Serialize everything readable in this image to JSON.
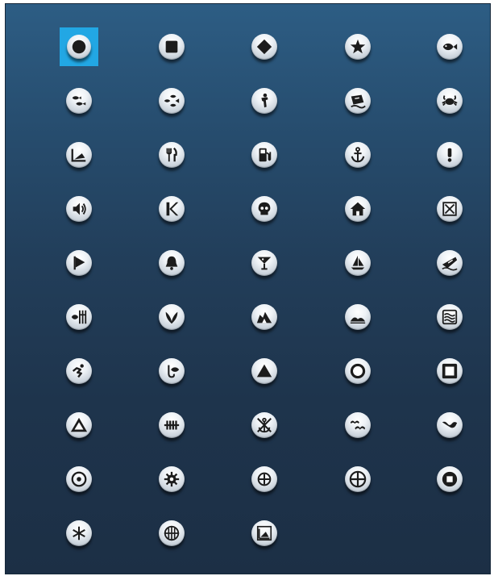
{
  "symbol_picker": {
    "selected_index": 0,
    "symbols": [
      {
        "icon": "filled-circle"
      },
      {
        "icon": "filled-square"
      },
      {
        "icon": "filled-diamond"
      },
      {
        "icon": "star"
      },
      {
        "icon": "fish"
      },
      {
        "icon": "two-fish"
      },
      {
        "icon": "three-fish"
      },
      {
        "icon": "diver"
      },
      {
        "icon": "shipwreck"
      },
      {
        "icon": "crab"
      },
      {
        "icon": "wreck-angle"
      },
      {
        "icon": "restaurant"
      },
      {
        "icon": "fuel-pump"
      },
      {
        "icon": "anchor"
      },
      {
        "icon": "exclamation"
      },
      {
        "icon": "speaker"
      },
      {
        "icon": "kayak-flag"
      },
      {
        "icon": "skull"
      },
      {
        "icon": "house"
      },
      {
        "icon": "x-box"
      },
      {
        "icon": "flag"
      },
      {
        "icon": "bell"
      },
      {
        "icon": "cocktail"
      },
      {
        "icon": "sailboat"
      },
      {
        "icon": "powerboat"
      },
      {
        "icon": "dock-fish"
      },
      {
        "icon": "weed"
      },
      {
        "icon": "rocks"
      },
      {
        "icon": "hills"
      },
      {
        "icon": "reef-waves"
      },
      {
        "icon": "swimmer"
      },
      {
        "icon": "fish-hook"
      },
      {
        "icon": "triangle"
      },
      {
        "icon": "hollow-circle"
      },
      {
        "icon": "hollow-square"
      },
      {
        "icon": "hollow-triangle"
      },
      {
        "icon": "fence"
      },
      {
        "icon": "no-anchor"
      },
      {
        "icon": "birds"
      },
      {
        "icon": "bird"
      },
      {
        "icon": "dot-circle"
      },
      {
        "icon": "gear"
      },
      {
        "icon": "crosshair"
      },
      {
        "icon": "crosshair-large"
      },
      {
        "icon": "small-square"
      },
      {
        "icon": "asterisk"
      },
      {
        "icon": "compass-cross"
      },
      {
        "icon": "wreck-box"
      }
    ]
  }
}
